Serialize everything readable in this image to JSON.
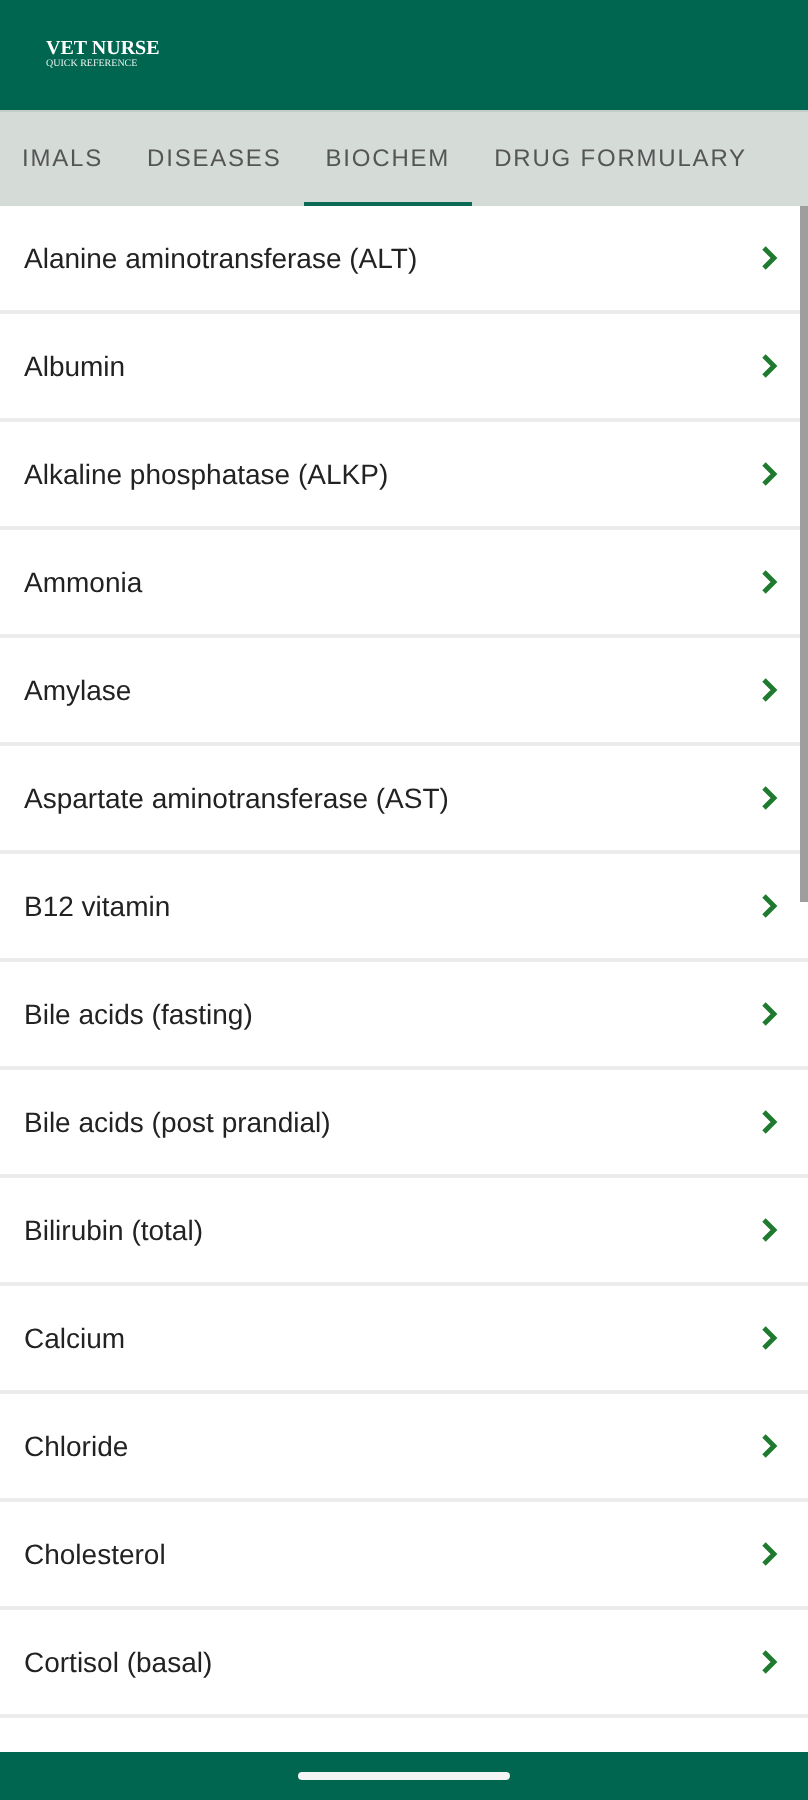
{
  "app_bar": {
    "title": "VET NURSE",
    "subtitle": "QUICK REFERENCE"
  },
  "tabs": [
    {
      "label": "IMALS",
      "selected": false
    },
    {
      "label": "DISEASES",
      "selected": false
    },
    {
      "label": "BIOCHEM",
      "selected": true
    },
    {
      "label": "DRUG FORMULARY",
      "selected": false
    }
  ],
  "items": [
    {
      "label": "Alanine aminotransferase (ALT)"
    },
    {
      "label": "Albumin"
    },
    {
      "label": "Alkaline phosphatase (ALKP)"
    },
    {
      "label": "Ammonia"
    },
    {
      "label": "Amylase"
    },
    {
      "label": "Aspartate aminotransferase (AST)"
    },
    {
      "label": "B12 vitamin"
    },
    {
      "label": "Bile acids (fasting)"
    },
    {
      "label": "Bile acids (post prandial)"
    },
    {
      "label": "Bilirubin (total)"
    },
    {
      "label": "Calcium"
    },
    {
      "label": "Chloride"
    },
    {
      "label": "Cholesterol"
    },
    {
      "label": "Cortisol (basal)"
    }
  ]
}
